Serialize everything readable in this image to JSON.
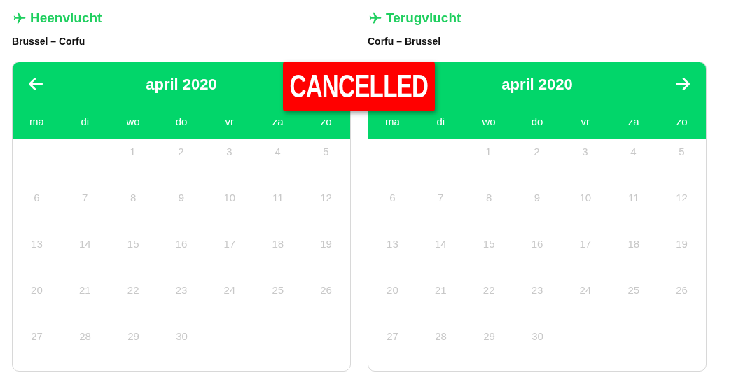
{
  "flights": [
    {
      "title": "Heenvlucht",
      "route": "Brussel – Corfu",
      "month": "april 2020",
      "nav": {
        "kind": "prev"
      },
      "disabled": true,
      "weekdays": [
        "ma",
        "di",
        "wo",
        "do",
        "vr",
        "za",
        "zo"
      ],
      "weeks": [
        {
          "kind": "lead",
          "days": [
            "1",
            "2",
            "3",
            "4",
            "5"
          ]
        },
        {
          "kind": "plain",
          "days": [
            "6",
            "7",
            "8",
            "9",
            "10",
            "11",
            "12"
          ]
        },
        {
          "kind": "plain",
          "days": [
            "13",
            "14",
            "15",
            "16",
            "17",
            "18",
            "19"
          ]
        },
        {
          "kind": "plain",
          "days": [
            "20",
            "21",
            "22",
            "23",
            "24",
            "25",
            "26"
          ]
        },
        {
          "kind": "plain",
          "days": [
            "27",
            "28",
            "29",
            "30"
          ]
        }
      ]
    },
    {
      "title": "Terugvlucht",
      "route": "Corfu – Brussel",
      "month": "april 2020",
      "nav": {
        "kind": "next"
      },
      "disabled": true,
      "weekdays": [
        "ma",
        "di",
        "wo",
        "do",
        "vr",
        "za",
        "zo"
      ],
      "weeks": [
        {
          "kind": "lead",
          "days": [
            "1",
            "2",
            "3",
            "4",
            "5"
          ]
        },
        {
          "kind": "plain",
          "days": [
            "6",
            "7",
            "8",
            "9",
            "10",
            "11",
            "12"
          ]
        },
        {
          "kind": "plain",
          "days": [
            "13",
            "14",
            "15",
            "16",
            "17",
            "18",
            "19"
          ]
        },
        {
          "kind": "plain",
          "days": [
            "20",
            "21",
            "22",
            "23",
            "24",
            "25",
            "26"
          ]
        },
        {
          "kind": "plain",
          "days": [
            "27",
            "28",
            "29",
            "30"
          ]
        }
      ]
    }
  ],
  "stamp": {
    "text": "CANCELLED"
  }
}
